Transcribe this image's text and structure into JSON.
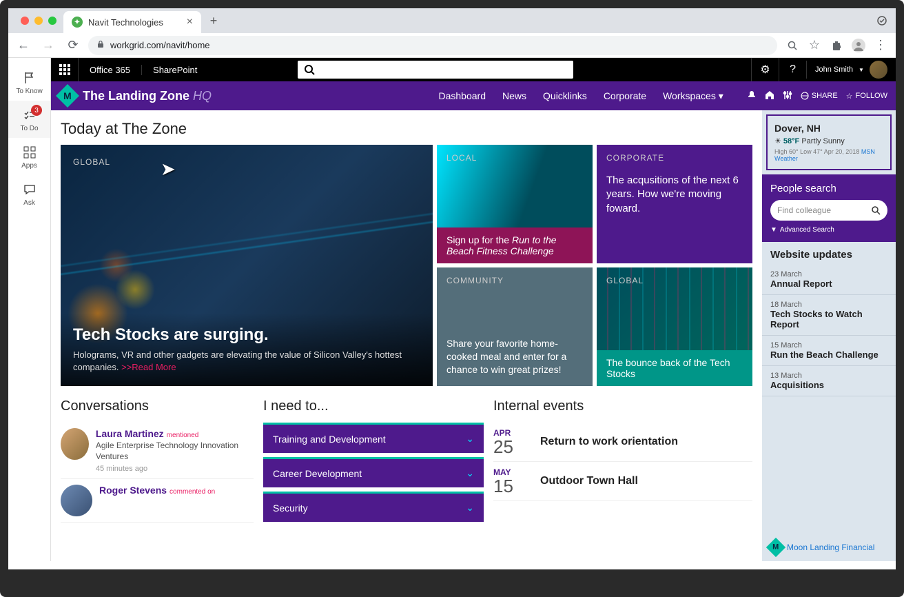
{
  "browser": {
    "tab_title": "Navit Technologies",
    "url": "workgrid.com/navit/home"
  },
  "left_rail": {
    "items": [
      {
        "label": "To Know"
      },
      {
        "label": "To Do",
        "badge": "3"
      },
      {
        "label": "Apps"
      },
      {
        "label": "Ask"
      }
    ]
  },
  "o365": {
    "brand": "Office 365",
    "app": "SharePoint",
    "user": "John Smith"
  },
  "site": {
    "title_main": "The Landing Zone",
    "title_suffix": "HQ",
    "nav": [
      "Dashboard",
      "News",
      "Quicklinks",
      "Corporate",
      "Workspaces ▾"
    ],
    "share": "SHARE",
    "follow": "FOLLOW"
  },
  "page": {
    "title": "Today at The Zone"
  },
  "hero": {
    "tag": "GLOBAL",
    "title": "Tech Stocks are surging.",
    "desc": "Holograms, VR and other gadgets are elevating the value of Silicon Valley's hottest companies.  ",
    "readmore": ">>Read More"
  },
  "tiles": {
    "local": {
      "tag": "LOCAL",
      "caption_a": "Sign up for the ",
      "caption_b": "Run to the Beach Fitness Challenge"
    },
    "corporate": {
      "tag": "CORPORATE",
      "body": "The acqusitions of the next 6 years. How we're moving foward."
    },
    "community": {
      "tag": "COMMUNITY",
      "body": "Share your favorite home-cooked meal and enter for a chance to win great prizes!"
    },
    "global2": {
      "tag": "GLOBAL",
      "caption": "The bounce back of the Tech Stocks"
    }
  },
  "conversations": {
    "title": "Conversations",
    "items": [
      {
        "name": "Laura Martinez",
        "meta": "mentioned",
        "sub": "Agile Enterprise Technology Innovation Ventures",
        "time": "45 minutes ago"
      },
      {
        "name": "Roger Stevens",
        "meta": "commented on",
        "sub": "",
        "time": ""
      }
    ]
  },
  "need": {
    "title": "I need to...",
    "items": [
      "Training and Development",
      "Career Development",
      "Security"
    ]
  },
  "events": {
    "title": "Internal events",
    "items": [
      {
        "month": "APR",
        "day": "25",
        "title": "Return to work orientation"
      },
      {
        "month": "MAY",
        "day": "15",
        "title": "Outdoor Town Hall"
      }
    ]
  },
  "weather": {
    "location": "Dover, NH",
    "temp": "58°F",
    "cond": "Partly Sunny",
    "high": "High 60°",
    "low": "Low 47°",
    "date": "Apr 20, 2018",
    "source": "MSN Weather"
  },
  "people_search": {
    "title": "People search",
    "placeholder": "Find colleague",
    "advanced": "Advanced Search"
  },
  "updates": {
    "title": "Website updates",
    "items": [
      {
        "date": "23 March",
        "title": "Annual Report"
      },
      {
        "date": "18 March",
        "title": "Tech Stocks to Watch Report"
      },
      {
        "date": "15 March",
        "title": "Run the Beach Challenge"
      },
      {
        "date": "13 March",
        "title": "Acquisitions"
      }
    ]
  },
  "footer_brand": "Moon Landing Financial"
}
